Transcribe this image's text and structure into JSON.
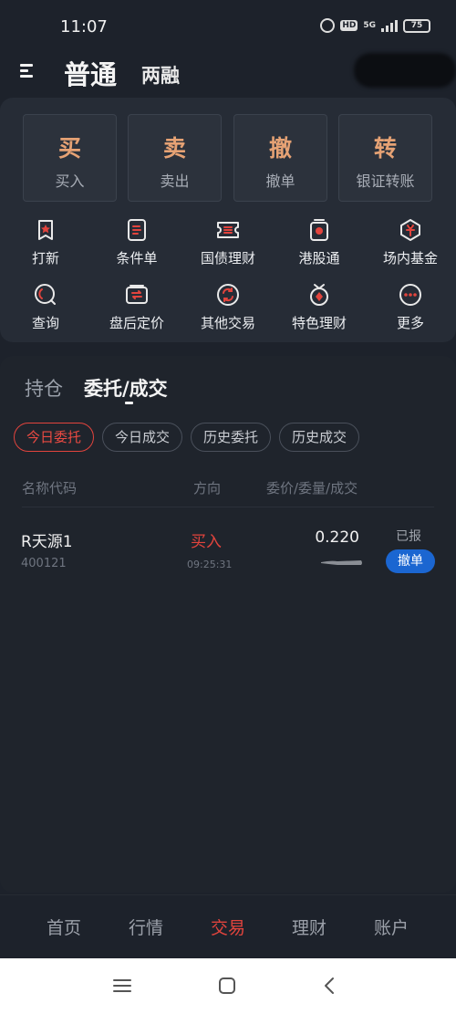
{
  "status_bar": {
    "time": "11:07",
    "network": "5G",
    "hd": "HD",
    "battery": "75"
  },
  "header": {
    "title": "普通",
    "subtitle": "两融"
  },
  "quick_actions": [
    {
      "glyph": "买",
      "label": "买入"
    },
    {
      "glyph": "卖",
      "label": "卖出"
    },
    {
      "glyph": "撤",
      "label": "撤单"
    },
    {
      "glyph": "转",
      "label": "银证转账"
    }
  ],
  "grid": [
    {
      "label": "打新",
      "icon": "ipo-icon"
    },
    {
      "label": "条件单",
      "icon": "condition-order-icon"
    },
    {
      "label": "国债理财",
      "icon": "treasury-icon"
    },
    {
      "label": "港股通",
      "icon": "hk-connect-icon"
    },
    {
      "label": "场内基金",
      "icon": "fund-icon"
    },
    {
      "label": "查询",
      "icon": "query-icon"
    },
    {
      "label": "盘后定价",
      "icon": "after-hours-icon"
    },
    {
      "label": "其他交易",
      "icon": "other-trade-icon"
    },
    {
      "label": "特色理财",
      "icon": "featured-wealth-icon"
    },
    {
      "label": "更多",
      "icon": "more-icon"
    }
  ],
  "tabs": {
    "holdings": "持仓",
    "entrust": "委托/成交"
  },
  "chips": [
    "今日委托",
    "今日成交",
    "历史委托",
    "历史成交"
  ],
  "table": {
    "headers": {
      "name": "名称代码",
      "direction": "方向",
      "price": "委价/委量/成交"
    },
    "rows": [
      {
        "name": "R天源1",
        "code": "400121",
        "direction": "买入",
        "time": "09:25:31",
        "price": "0.220",
        "status": "已报",
        "action": "撤单"
      }
    ]
  },
  "bottom_nav": [
    "首页",
    "行情",
    "交易",
    "理财",
    "账户"
  ],
  "colors": {
    "accent": "#e2443d",
    "orange": "#e6a274",
    "blue": "#1b66d1",
    "bg": "#1d222b"
  }
}
